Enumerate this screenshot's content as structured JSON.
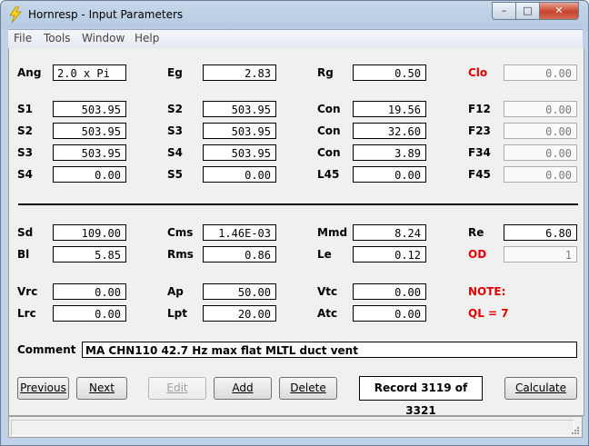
{
  "window": {
    "title": "Hornresp - Input Parameters"
  },
  "menu": [
    "File",
    "Tools",
    "Window",
    "Help"
  ],
  "params": [
    {
      "label": "Ang",
      "value": "2.0 x Pi"
    },
    {
      "label": "Eg",
      "value": "2.83"
    },
    {
      "label": "Rg",
      "value": "0.50"
    },
    {
      "label": "Clo",
      "value": "0.00"
    },
    {
      "label": "S1",
      "value": "503.95"
    },
    {
      "label": "S2",
      "value": "503.95"
    },
    {
      "label": "Con",
      "value": "19.56"
    },
    {
      "label": "F12",
      "value": "0.00"
    },
    {
      "label": "S2",
      "value": "503.95"
    },
    {
      "label": "S3",
      "value": "503.95"
    },
    {
      "label": "Con",
      "value": "32.60"
    },
    {
      "label": "F23",
      "value": "0.00"
    },
    {
      "label": "S3",
      "value": "503.95"
    },
    {
      "label": "S4",
      "value": "503.95"
    },
    {
      "label": "Con",
      "value": "3.89"
    },
    {
      "label": "F34",
      "value": "0.00"
    },
    {
      "label": "S4",
      "value": "0.00"
    },
    {
      "label": "S5",
      "value": "0.00"
    },
    {
      "label": "L45",
      "value": "0.00"
    },
    {
      "label": "F45",
      "value": "0.00"
    },
    {
      "label": "Sd",
      "value": "109.00"
    },
    {
      "label": "Cms",
      "value": "1.46E-03"
    },
    {
      "label": "Mmd",
      "value": "8.24"
    },
    {
      "label": "Re",
      "value": "6.80"
    },
    {
      "label": "Bl",
      "value": "5.85"
    },
    {
      "label": "Rms",
      "value": "0.86"
    },
    {
      "label": "Le",
      "value": "0.12"
    },
    {
      "label": "OD",
      "value": "1"
    },
    {
      "label": "Vrc",
      "value": "0.00"
    },
    {
      "label": "Ap",
      "value": "50.00"
    },
    {
      "label": "Vtc",
      "value": "0.00"
    },
    {
      "label": "Lrc",
      "value": "0.00"
    },
    {
      "label": "Lpt",
      "value": "20.00"
    },
    {
      "label": "Atc",
      "value": "0.00"
    }
  ],
  "notes": {
    "note": "NOTE:",
    "ql": "QL = 7"
  },
  "comment": {
    "label": "Comment",
    "value": "MA CHN110 42.7 Hz max flat MLTL duct vent"
  },
  "buttons": {
    "previous": "Previous",
    "next": "Next",
    "edit": "Edit",
    "add": "Add",
    "delete": "Delete",
    "calculate": "Calculate"
  },
  "record": "Record 3119 of 3321",
  "colors": {
    "red_label": "#e00000",
    "titlebar": "#b9cde3"
  },
  "icons": {
    "app": "lightning-icon"
  }
}
